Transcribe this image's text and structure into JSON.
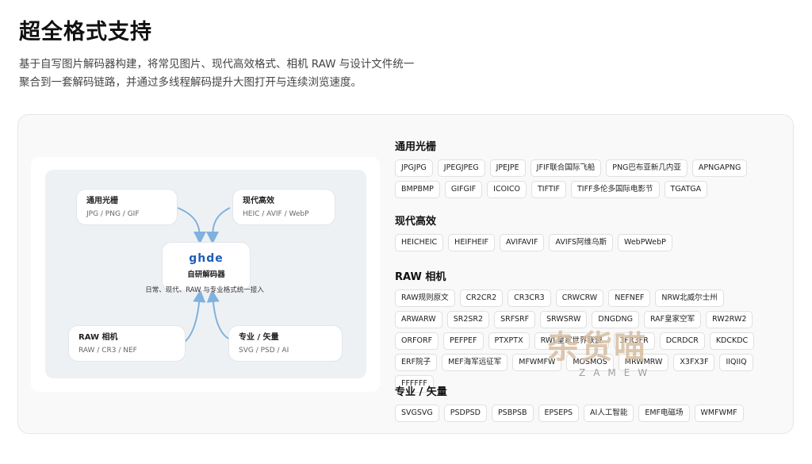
{
  "page": {
    "title": "超全格式支持",
    "desc_line1": "基于自写图片解码器构建，将常见图片、现代高效格式、相机 RAW 与设计文件统一",
    "desc_line2": "聚合到一套解码链路，并通过多线程解码提升大图打开与连续浏览速度。"
  },
  "diagram": {
    "nodes": [
      {
        "title": "通用光栅",
        "sub": "JPG / PNG / GIF"
      },
      {
        "title": "现代高效",
        "sub": "HEIC / AVIF / WebP"
      },
      {
        "title": "RAW 相机",
        "sub": "RAW / CR3 / NEF"
      },
      {
        "title": "专业 / 矢量",
        "sub": "SVG / PSD / AI"
      }
    ],
    "center": {
      "logo": "ghde",
      "name": "自研解码器",
      "sub": "日常、现代、RAW 与专业格式统一接入"
    },
    "arrow_color": "#7fb2dd"
  },
  "sections": [
    {
      "title": "通用光栅",
      "tags": [
        "JPGJPG",
        "JPEGJPEG",
        "JPEJPE",
        "JFIF联合国际飞船",
        "PNG巴布亚新几内亚",
        "APNGAPNG",
        "BMPBMP",
        "GIFGIF",
        "ICOICO",
        "TIFTIF",
        "TIFF多伦多国际电影节",
        "TGATGA"
      ]
    },
    {
      "title": "现代高效",
      "tags": [
        "HEICHEIC",
        "HEIFHEIF",
        "AVIFAVIF",
        "AVIFS阿维乌斯",
        "WebPWebP"
      ]
    },
    {
      "title": "RAW 相机",
      "tags": [
        "RAW规则原文",
        "CR2CR2",
        "CR3CR3",
        "CRWCRW",
        "NEFNEF",
        "NRW北威尔士州",
        "ARWARW",
        "SR2SR2",
        "SRFSRF",
        "SRWSRW",
        "DNGDNG",
        "RAF皇家空军",
        "RW2RW2",
        "ORFORF",
        "PEFPEF",
        "PTXPTX",
        "RWL皇家世界联盟",
        "3FR3FR",
        "DCRDCR",
        "KDCKDC",
        "ERF院子",
        "MEF海军远征军",
        "MFWMFW",
        "MOSMOS",
        "MRWMRW",
        "X3FX3F",
        "IIQIIQ",
        "FFFFFF"
      ]
    },
    {
      "title": "专业 / 矢量",
      "tags": [
        "SVGSVG",
        "PSDPSD",
        "PSBPSB",
        "EPSEPS",
        "AI人工智能",
        "EMF电磁场",
        "WMFWMF"
      ]
    }
  ],
  "watermark": {
    "text": "杂货喵",
    "sub": "ZAMEW"
  }
}
